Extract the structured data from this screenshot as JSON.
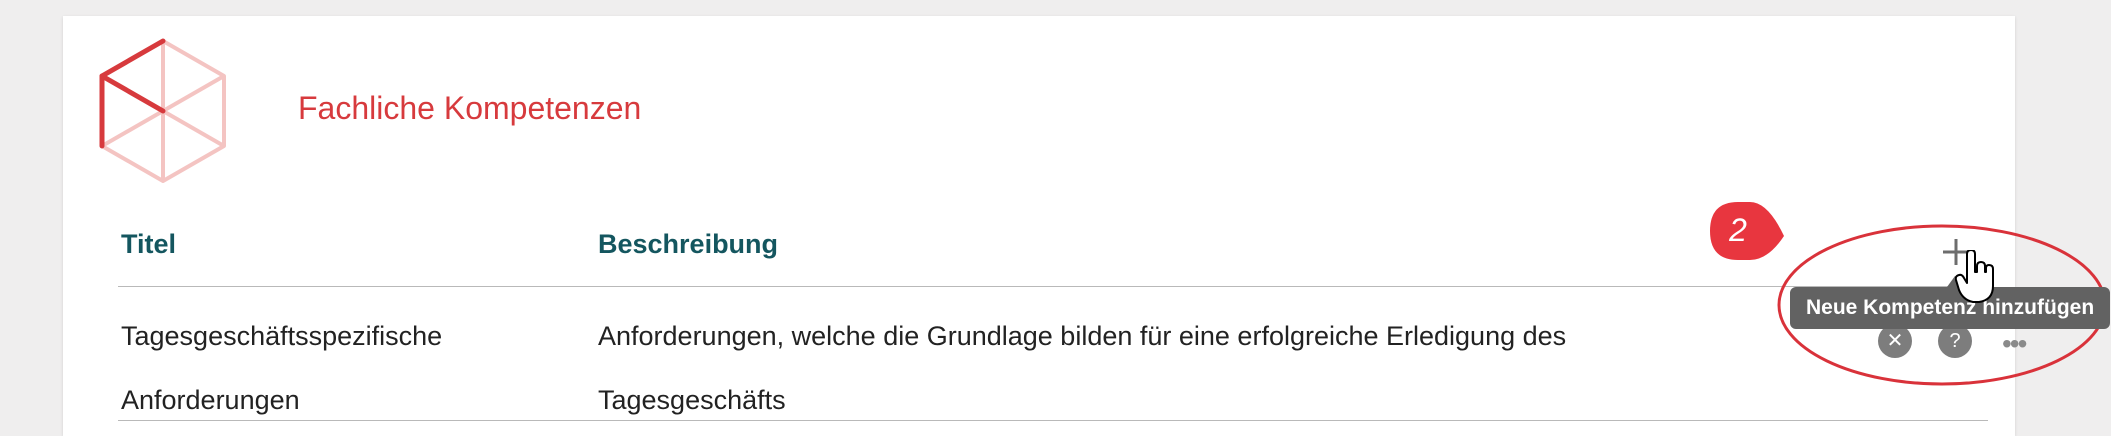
{
  "section": {
    "title": "Fachliche Kompetenzen"
  },
  "table": {
    "headers": [
      "Titel",
      "Beschreibung"
    ],
    "rows": [
      {
        "title": "Tagesgeschäftsspezifische Anforderungen",
        "title_line1": "Tagesgeschäftsspezifische",
        "title_line2": "Anforderungen",
        "description_line1": "Anforderungen, welche die Grundlage bilden für eine erfolgreiche Erledigung des",
        "description_line2": "Tagesgeschäfts"
      }
    ]
  },
  "actions": {
    "add_tooltip": "Neue Kompetenz hinzufügen"
  },
  "annotation": {
    "badge_number": "2",
    "badge_color": "#e8363f",
    "ellipse_color": "#d9323a"
  },
  "icons": {
    "logo": "cube-logo-icon",
    "add": "plus-icon",
    "delete": "close-icon",
    "help": "question-icon",
    "more": "more-dots-icon",
    "cursor": "hand-pointer-icon"
  },
  "colors": {
    "accent": "#d73a3d",
    "header_text": "#14565f",
    "logo_light": "#f4c4c2"
  }
}
